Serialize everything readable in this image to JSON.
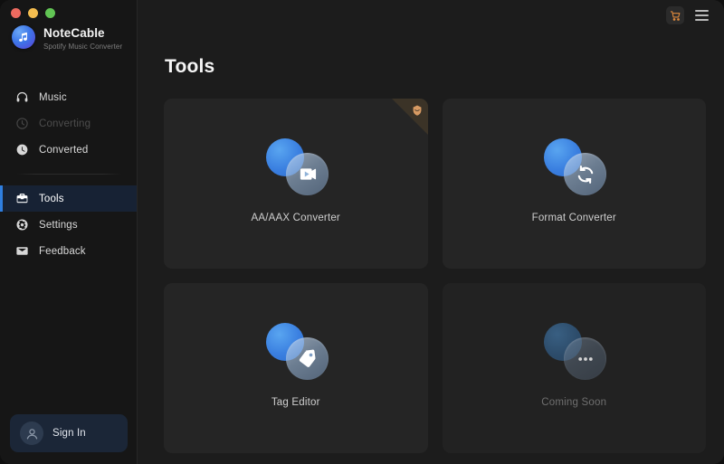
{
  "window": {
    "controls": [
      "close",
      "minimize",
      "maximize"
    ]
  },
  "sidebar": {
    "brand": {
      "name": "NoteCable",
      "subtitle": "Spotify Music Converter",
      "logo_icon": "music-note-icon"
    },
    "items": [
      {
        "label": "Music",
        "icon": "headphones-icon",
        "state": "normal"
      },
      {
        "label": "Converting",
        "icon": "converting-icon",
        "state": "disabled"
      },
      {
        "label": "Converted",
        "icon": "clock-icon",
        "state": "normal"
      },
      {
        "label": "Tools",
        "icon": "toolbox-icon",
        "state": "active"
      },
      {
        "label": "Settings",
        "icon": "gear-icon",
        "state": "normal"
      },
      {
        "label": "Feedback",
        "icon": "envelope-icon",
        "state": "normal"
      }
    ],
    "sign_in": {
      "label": "Sign In",
      "avatar_icon": "user-avatar-icon"
    }
  },
  "topbar": {
    "cart_icon": "shopping-cart-icon",
    "menu_icon": "hamburger-menu-icon"
  },
  "main": {
    "title": "Tools",
    "cards": [
      {
        "label": "AA/AAX Converter",
        "icon": "play-video-icon",
        "badge": "audible-badge-icon",
        "disabled": false
      },
      {
        "label": "Format Converter",
        "icon": "refresh-sync-icon",
        "badge": null,
        "disabled": false
      },
      {
        "label": "Tag Editor",
        "icon": "price-tag-icon",
        "badge": null,
        "disabled": false
      },
      {
        "label": "Coming Soon",
        "icon": "ellipsis-icon",
        "badge": null,
        "disabled": true
      }
    ]
  },
  "colors": {
    "app_background": "#1c1c1c",
    "sidebar_background": "#161616",
    "card_background": "#252525",
    "accent_blue": "#2f7fe0",
    "active_item_background": "#172234",
    "signin_background": "#1b2637",
    "cart_orange": "#e08a3c",
    "ribbon_background": "#3b3327"
  }
}
